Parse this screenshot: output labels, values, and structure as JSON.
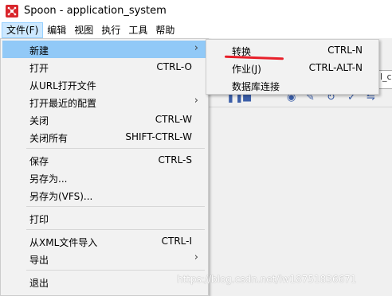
{
  "window": {
    "title": "Spoon - application_system"
  },
  "menubar": [
    {
      "label": "文件(F)"
    },
    {
      "label": "编辑"
    },
    {
      "label": "视图"
    },
    {
      "label": "执行"
    },
    {
      "label": "工具"
    },
    {
      "label": "帮助"
    }
  ],
  "file_menu": {
    "items": [
      {
        "label": "新建",
        "shortcut": "",
        "has_submenu": true,
        "highlighted": true
      },
      {
        "label": "打开",
        "shortcut": "CTRL-O"
      },
      {
        "label": "从URL打开文件",
        "shortcut": ""
      },
      {
        "label": "打开最近的配置",
        "shortcut": "",
        "has_submenu": true
      },
      {
        "label": "关闭",
        "shortcut": "CTRL-W"
      },
      {
        "label": "关闭所有",
        "shortcut": "SHIFT-CTRL-W"
      },
      {
        "label": "保存",
        "shortcut": "CTRL-S"
      },
      {
        "label": "另存为...",
        "shortcut": ""
      },
      {
        "label": "另存为(VFS)...",
        "shortcut": ""
      },
      {
        "label": "打印",
        "shortcut": ""
      },
      {
        "label": "从XML文件导入",
        "shortcut": "CTRL-I"
      },
      {
        "label": "导出",
        "shortcut": "",
        "has_submenu": true
      },
      {
        "label": "退出",
        "shortcut": ""
      }
    ]
  },
  "new_submenu": {
    "items": [
      {
        "label": "转换",
        "shortcut": "CTRL-N"
      },
      {
        "label": "作业(J)",
        "shortcut": "CTRL-ALT-N"
      },
      {
        "label": "数据库连接",
        "shortcut": ""
      }
    ]
  },
  "background": {
    "partial_text": "l_c"
  },
  "icons": {
    "arrow": "›",
    "app": "spoon-logo-icon"
  },
  "colors": {
    "highlight": "#91c9f7",
    "annotation": "#e8202a",
    "app_icon": "#d9262c"
  },
  "watermark": "https://blog.csdn.net/lw18751836671"
}
